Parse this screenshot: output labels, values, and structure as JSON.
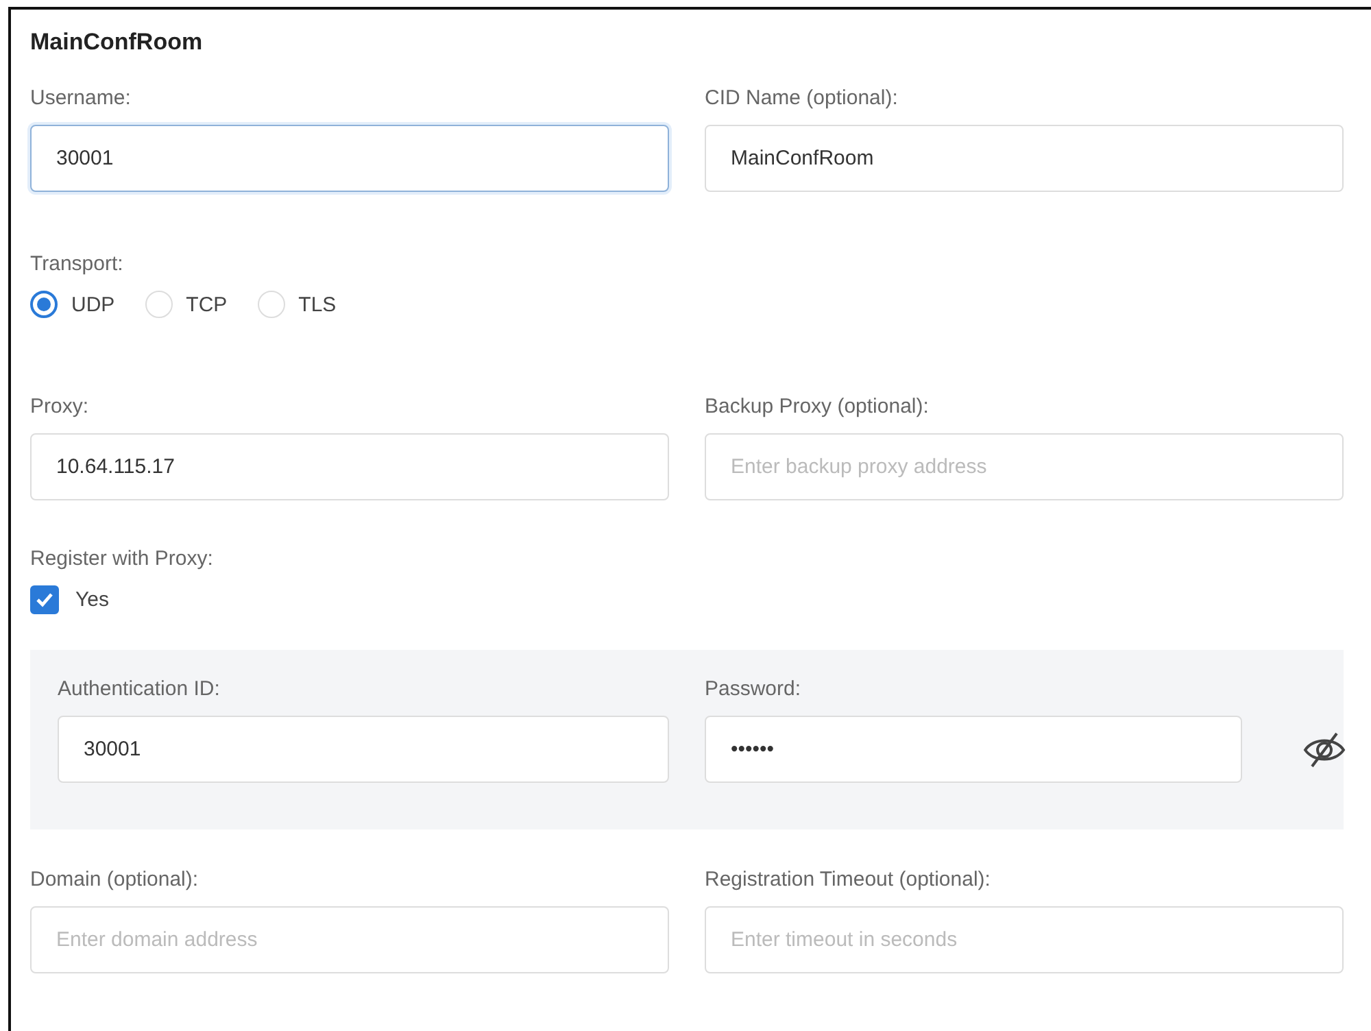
{
  "title": "MainConfRoom",
  "username": {
    "label": "Username:",
    "value": "30001",
    "focused": true
  },
  "cid_name": {
    "label": "CID Name (optional):",
    "value": "MainConfRoom",
    "focused": false
  },
  "transport": {
    "label": "Transport:",
    "options": [
      {
        "label": "UDP",
        "selected": true
      },
      {
        "label": "TCP",
        "selected": false
      },
      {
        "label": "TLS",
        "selected": false
      }
    ]
  },
  "proxy": {
    "label": "Proxy:",
    "value": "10.64.115.17",
    "focused": false
  },
  "backup_proxy": {
    "label": "Backup Proxy (optional):",
    "placeholder": "Enter backup proxy address",
    "focused": false
  },
  "register_with_proxy": {
    "label": "Register with Proxy:",
    "option": {
      "label": "Yes",
      "checked": true
    }
  },
  "authentication": {
    "auth_id": {
      "label": "Authentication ID:",
      "value": "30001",
      "focused": false
    },
    "password": {
      "label": "Password:",
      "value": "••••••",
      "focused": false
    }
  },
  "domain": {
    "label": "Domain (optional):",
    "placeholder": "Enter domain address",
    "focused": false
  },
  "registration_timeout": {
    "label": "Registration Timeout (optional):",
    "placeholder": "Enter timeout in seconds",
    "focused": false
  }
}
